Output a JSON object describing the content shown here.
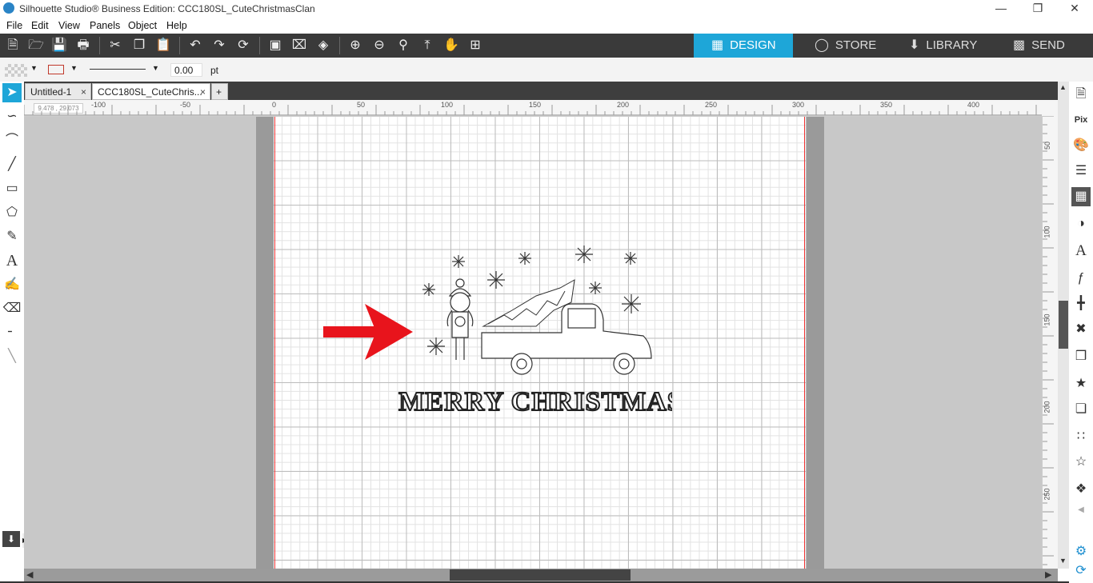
{
  "window": {
    "title": "Silhouette Studio® Business Edition: CCC180SL_CuteChristmasClan"
  },
  "menu": [
    "File",
    "Edit",
    "View",
    "Panels",
    "Object",
    "Help"
  ],
  "nav_tabs": [
    {
      "label": "DESIGN",
      "icon": "grid-icon",
      "active": true
    },
    {
      "label": "STORE",
      "icon": "silhouette-s-icon",
      "active": false
    },
    {
      "label": "LIBRARY",
      "icon": "library-icon",
      "active": false
    },
    {
      "label": "SEND",
      "icon": "cutter-icon",
      "active": false
    }
  ],
  "property_bar": {
    "line_width": "0.00",
    "unit": "pt"
  },
  "doc_tabs": [
    {
      "label": "Untitled-1"
    },
    {
      "label": "CCC180SL_CuteChris..."
    }
  ],
  "ruler": {
    "coords": "9.478 , 29.073",
    "h_labels": [
      "-100",
      "-50",
      "0",
      "50",
      "100",
      "150",
      "200",
      "250",
      "300",
      "350",
      "400"
    ],
    "v_labels": [
      "50",
      "100",
      "150",
      "200",
      "250"
    ]
  },
  "artwork": {
    "text": "MERRY CHRISTMAS",
    "annotation": "red-arrow"
  },
  "colors": {
    "accent": "#1ea6d8",
    "toolbar": "#3a3a3a",
    "arrow": "#e8141c"
  }
}
